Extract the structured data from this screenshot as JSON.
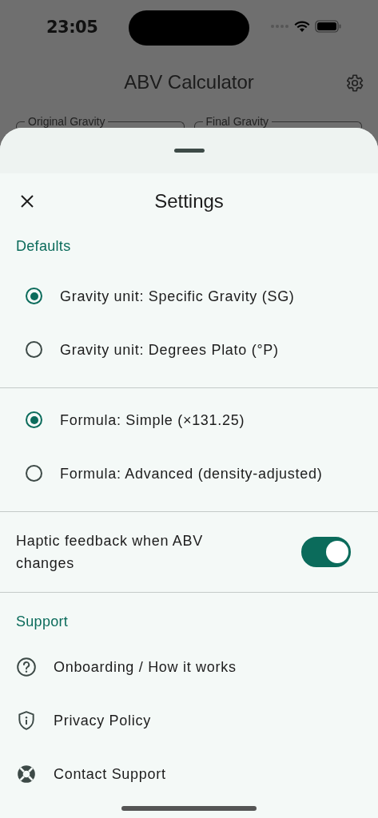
{
  "status_bar": {
    "time": "23:05"
  },
  "app_bar": {
    "title": "ABV Calculator"
  },
  "background_fields": [
    {
      "label": "Original Gravity"
    },
    {
      "label": "Final Gravity"
    }
  ],
  "sheet": {
    "title": "Settings",
    "defaults": {
      "header": "Defaults",
      "gravity_unit": [
        {
          "label": "Gravity unit: Specific Gravity (SG)",
          "selected": true
        },
        {
          "label": "Gravity unit: Degrees Plato (°P)",
          "selected": false
        }
      ],
      "formula": [
        {
          "label": "Formula: Simple (×131.25)",
          "selected": true
        },
        {
          "label": "Formula: Advanced (density-adjusted)",
          "selected": false
        }
      ]
    },
    "haptic": {
      "label": "Haptic feedback when ABV changes",
      "on": true
    },
    "support": {
      "header": "Support",
      "items": [
        {
          "label": "Onboarding / How it works",
          "kind": "help"
        },
        {
          "label": "Privacy Policy",
          "kind": "privacy"
        },
        {
          "label": "Contact Support",
          "kind": "support"
        }
      ]
    }
  }
}
